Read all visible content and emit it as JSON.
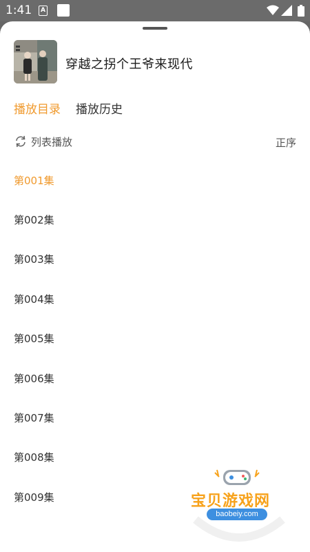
{
  "status_bar": {
    "time": "1:41",
    "icons": [
      "a-icon",
      "square-icon",
      "wifi-icon",
      "signal-icon",
      "battery-icon"
    ]
  },
  "sheet": {
    "title": "穿越之拐个王爷来现代",
    "tabs": [
      {
        "label": "播放目录",
        "active": true
      },
      {
        "label": "播放历史",
        "active": false
      }
    ],
    "mode_label": "列表播放",
    "mode_icon": "loop-icon",
    "order_label": "正序",
    "episodes": [
      {
        "label": "第001集",
        "active": true
      },
      {
        "label": "第002集",
        "active": false
      },
      {
        "label": "第003集",
        "active": false
      },
      {
        "label": "第004集",
        "active": false
      },
      {
        "label": "第005集",
        "active": false
      },
      {
        "label": "第006集",
        "active": false
      },
      {
        "label": "第007集",
        "active": false
      },
      {
        "label": "第008集",
        "active": false
      },
      {
        "label": "第009集",
        "active": false
      }
    ]
  },
  "watermark": {
    "name": "宝贝游戏网",
    "url": "baobeiy.com"
  },
  "colors": {
    "accent": "#f09a2e",
    "text": "#333333",
    "backdrop": "#666666"
  }
}
